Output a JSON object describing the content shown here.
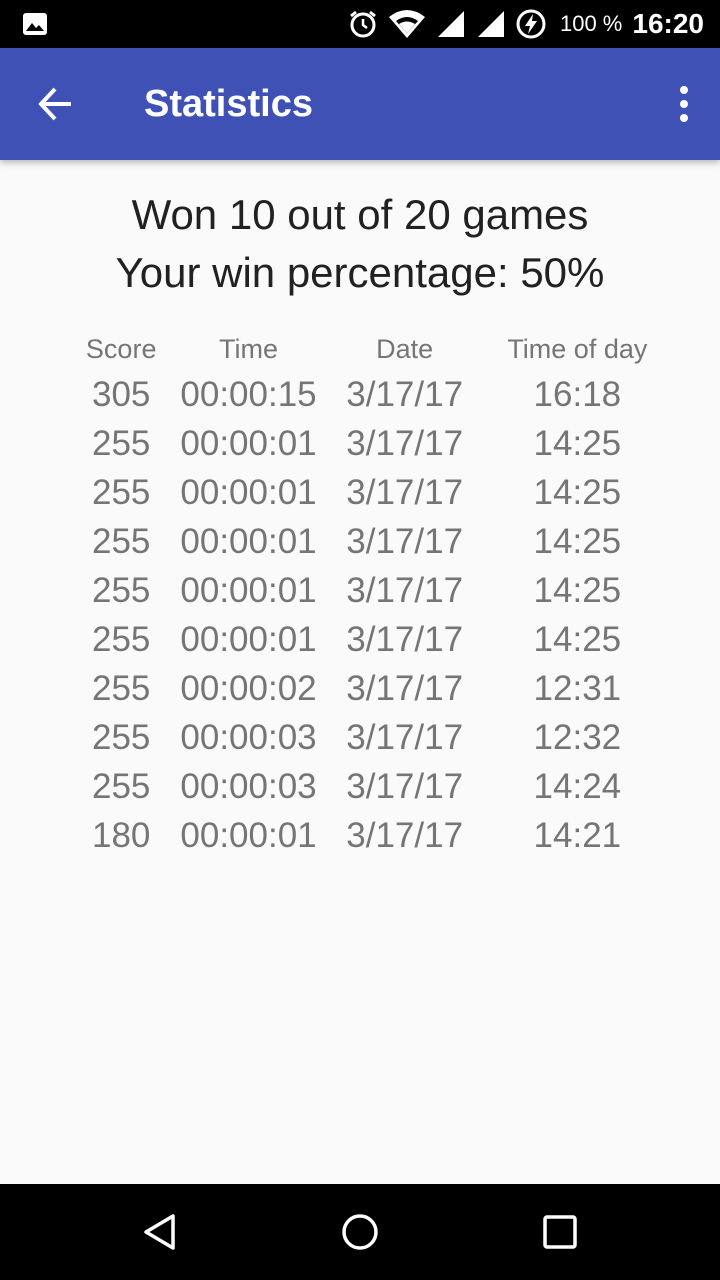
{
  "status_bar": {
    "icons": [
      "image-icon",
      "alarm-icon",
      "wifi-icon",
      "signal-icon",
      "signal-icon",
      "battery-charging-icon"
    ],
    "battery": "100 %",
    "time": "16:20"
  },
  "app_bar": {
    "title": "Statistics",
    "back_icon": "arrow-back-icon",
    "menu_icon": "more-vert-icon",
    "color": "#3f51b5"
  },
  "summary": {
    "line1": "Won 10 out of 20 games",
    "line2": "Your win percentage: 50%"
  },
  "table": {
    "headers": [
      "Score",
      "Time",
      "Date",
      "Time of day"
    ],
    "rows": [
      [
        "305",
        "00:00:15",
        "3/17/17",
        "16:18"
      ],
      [
        "255",
        "00:00:01",
        "3/17/17",
        "14:25"
      ],
      [
        "255",
        "00:00:01",
        "3/17/17",
        "14:25"
      ],
      [
        "255",
        "00:00:01",
        "3/17/17",
        "14:25"
      ],
      [
        "255",
        "00:00:01",
        "3/17/17",
        "14:25"
      ],
      [
        "255",
        "00:00:01",
        "3/17/17",
        "14:25"
      ],
      [
        "255",
        "00:00:02",
        "3/17/17",
        "12:31"
      ],
      [
        "255",
        "00:00:03",
        "3/17/17",
        "12:32"
      ],
      [
        "255",
        "00:00:03",
        "3/17/17",
        "14:24"
      ],
      [
        "180",
        "00:00:01",
        "3/17/17",
        "14:21"
      ]
    ]
  },
  "nav_bar": {
    "icons": [
      "back-triangle-icon",
      "home-circle-icon",
      "recents-square-icon"
    ]
  }
}
